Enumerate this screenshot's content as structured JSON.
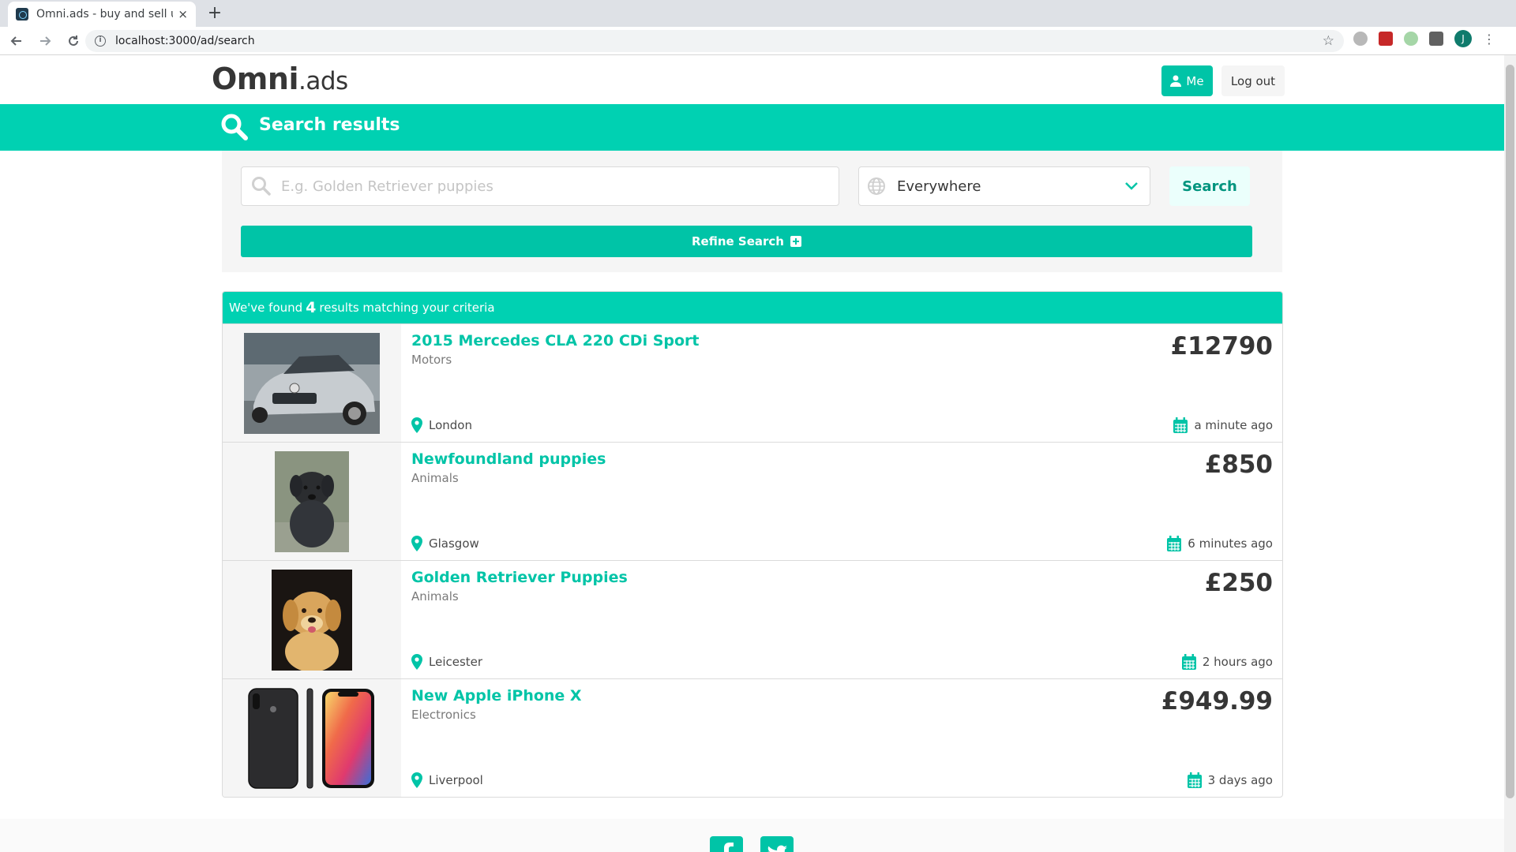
{
  "browser": {
    "tab_title": "Omni.ads - buy and sell u",
    "tab_close": "×",
    "new_tab": "+",
    "url": "localhost:3000/ad/search",
    "profile_initial": "J"
  },
  "navbar": {
    "logo_brand": "Omni",
    "logo_suffix": ".ads",
    "me_label": "Me",
    "logout_label": "Log out"
  },
  "hero": {
    "title": "Search results"
  },
  "search": {
    "placeholder": "E.g. Golden Retriever puppies",
    "value": "",
    "location": "Everywhere",
    "search_label": "Search",
    "refine_label": "Refine Search"
  },
  "results": {
    "prefix": "We've found",
    "count": "4",
    "suffix": "results matching your criteria",
    "items": [
      {
        "title": "2015 Mercedes CLA 220 CDi Sport",
        "category": "Motors",
        "price": "£12790",
        "location": "London",
        "time": "a minute ago"
      },
      {
        "title": "Newfoundland puppies",
        "category": "Animals",
        "price": "£850",
        "location": "Glasgow",
        "time": "6 minutes ago"
      },
      {
        "title": "Golden Retriever Puppies",
        "category": "Animals",
        "price": "£250",
        "location": "Leicester",
        "time": "2 hours ago"
      },
      {
        "title": "New Apple iPhone X",
        "category": "Electronics",
        "price": "£949.99",
        "location": "Liverpool",
        "time": "3 days ago"
      }
    ]
  },
  "colors": {
    "primary": "#00d1b2",
    "primary_dark": "#00c4a7",
    "text": "#363636",
    "muted": "#7a7a7a"
  }
}
